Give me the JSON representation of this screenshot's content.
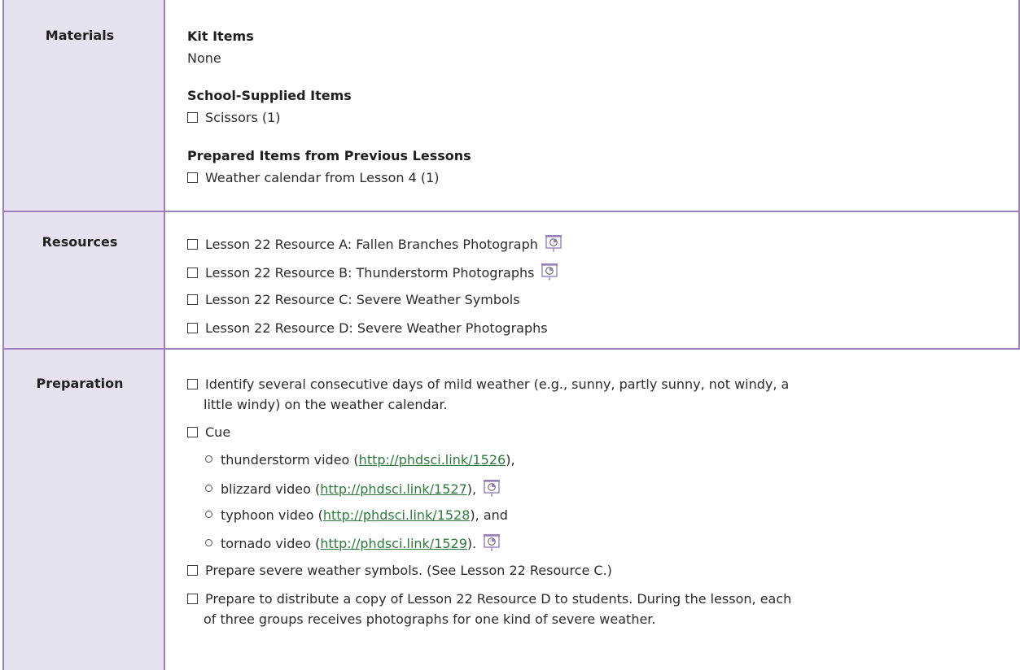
{
  "materials": {
    "label": "Materials",
    "kit_heading": "Kit Items",
    "kit_value": "None",
    "school_heading": "School-Supplied Items",
    "school_items": [
      "Scissors (1)"
    ],
    "prepared_heading": "Prepared Items from Previous Lessons",
    "prepared_items": [
      "Weather calendar from Lesson 4 (1)"
    ]
  },
  "resources": {
    "label": "Resources",
    "items": [
      "Lesson 22 Resource A: Fallen Branches Photograph",
      "Lesson 22 Resource B: Thunderstorm Photographs",
      "Lesson 22 Resource C: Severe Weather Symbols",
      "Lesson 22 Resource D: Severe Weather Photographs"
    ]
  },
  "preparation": {
    "label": "Preparation",
    "item1_line1": "Identify several consecutive days of mild weather (e.g., sunny, partly sunny, not windy, a",
    "item1_line2": "little windy) on the weather calendar.",
    "cue_label": "Cue",
    "cue_items": [
      {
        "prefix": "thunderstorm video (",
        "link": "http://phdsci.link/1526",
        "suffix": "),"
      },
      {
        "prefix": "blizzard video (",
        "link": "http://phdsci.link/1527",
        "suffix": "),"
      },
      {
        "prefix": "typhoon video (",
        "link": "http://phdsci.link/1528",
        "suffix": "), and"
      },
      {
        "prefix": "tornado video (",
        "link": "http://phdsci.link/1529",
        "suffix": ")."
      }
    ],
    "item3": "Prepare severe weather symbols. (See Lesson 22 Resource C.)",
    "item4_line1": "Prepare to distribute a copy of Lesson 22 Resource D to students. During the lesson, each",
    "item4_line2": "of three groups receives photographs for one kind of severe weather."
  },
  "icons": {
    "checkbox": "checkbox-icon",
    "projector": "projector-screen-icon",
    "bullet": "circle-bullet-icon"
  },
  "colors": {
    "accent": "#9a7fbd",
    "label_bg": "#e8e1f0",
    "link": "#2e7a3c"
  }
}
